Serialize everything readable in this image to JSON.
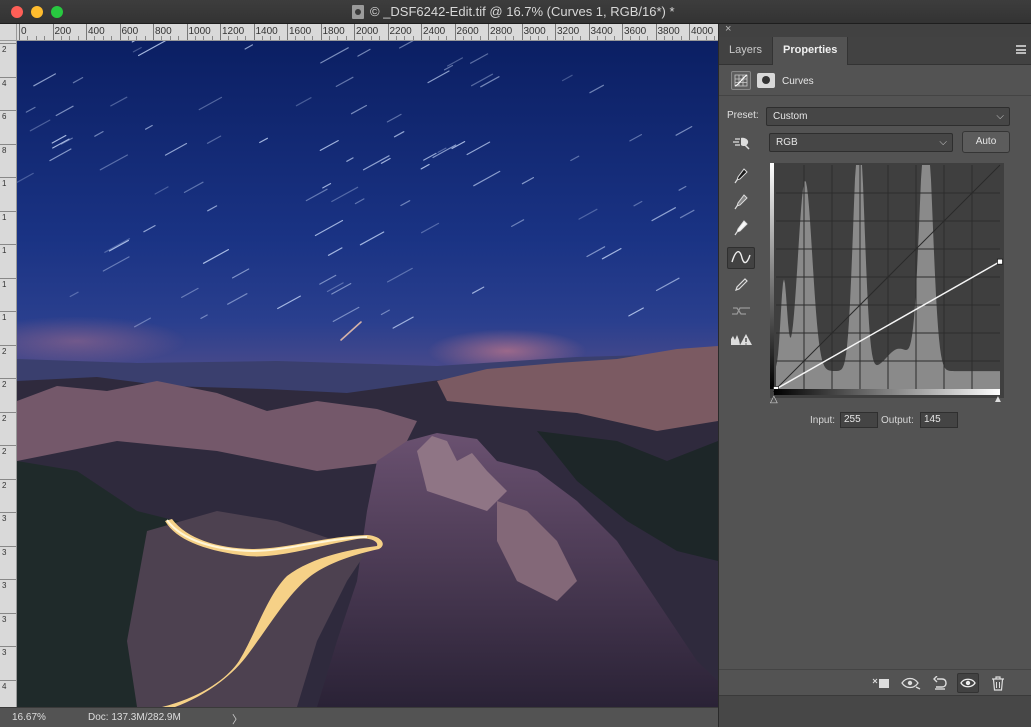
{
  "window": {
    "title": "© _DSF6242-Edit.tif @ 16.7% (Curves 1, RGB/16*) *"
  },
  "ruler": {
    "top_labels": [
      "0",
      "200",
      "400",
      "600",
      "800",
      "1000",
      "1200",
      "1400",
      "1600",
      "1800",
      "2000",
      "2200",
      "2400",
      "2600",
      "2800",
      "3000",
      "3200",
      "3400",
      "3600",
      "3800",
      "4000"
    ],
    "left_labels": [
      "2",
      "4",
      "6",
      "8",
      "1",
      "1",
      "1",
      "1",
      "1",
      "2",
      "2",
      "2",
      "2",
      "2",
      "3",
      "3",
      "3",
      "3",
      "3",
      "4"
    ]
  },
  "status": {
    "zoom": "16.67%",
    "doc": "Doc: 137.3M/282.9M",
    "arrow": "〉"
  },
  "panel": {
    "close": "×",
    "tabs": [
      "Layers",
      "Properties"
    ],
    "active_tab": "Properties",
    "adjustment_title": "Curves",
    "preset_label": "Preset:",
    "preset_value": "Custom",
    "channel_value": "RGB",
    "auto_label": "Auto",
    "input_label": "Input:",
    "input_value": "255",
    "output_label": "Output:",
    "output_value": "145",
    "tools": [
      "on-image-adjust-icon",
      "black-point-eyedropper-icon",
      "gray-point-eyedropper-icon",
      "white-point-eyedropper-icon",
      "curve-point-icon",
      "pencil-draw-icon",
      "smooth-curve-icon",
      "clipping-warning-icon"
    ],
    "bottom_buttons": [
      "clip-to-layer-icon",
      "view-previous-icon",
      "reset-icon",
      "visibility-eye-icon",
      "trash-icon"
    ]
  },
  "curve": {
    "input_range": [
      0,
      255
    ],
    "output_range": [
      0,
      255
    ],
    "points": [
      [
        0,
        0
      ],
      [
        255,
        145
      ]
    ]
  },
  "colors": {
    "panel_bg": "#535353",
    "sky_top": "#0b1f63",
    "sky_bottom": "#2a3f8e",
    "light_trail": "#ffd98a"
  }
}
